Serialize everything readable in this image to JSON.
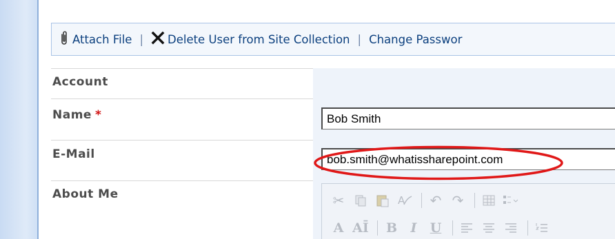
{
  "toolbar": {
    "attach_file": "Attach File",
    "delete_user": "Delete User from Site Collection",
    "change_password": "Change Passwor",
    "separator": "|"
  },
  "form": {
    "section_title": "Account",
    "fields": [
      {
        "label": "Name",
        "required_marker": "*",
        "value": "Bob Smith"
      },
      {
        "label": "E-Mail",
        "value": "bob.smith@whatissharepoint.com"
      },
      {
        "label": "About Me"
      }
    ]
  },
  "editor_toolbar": {
    "row1_icons": [
      "cut-icon",
      "copy-icon",
      "paste-icon",
      "paste-plain-icon",
      "undo-icon",
      "redo-icon",
      "table-icon",
      "list-style-icon"
    ],
    "row2_labels": {
      "font_color": "A",
      "font_size": "AĪ",
      "bold": "B",
      "italic": "I",
      "underline": "U"
    }
  },
  "colors": {
    "toolbar_text": "#0b3f7e",
    "label_text": "#4c4c4c",
    "required": "#d01010",
    "highlight_ellipse": "#e01818",
    "value_column_bg": "#eef3fa"
  }
}
